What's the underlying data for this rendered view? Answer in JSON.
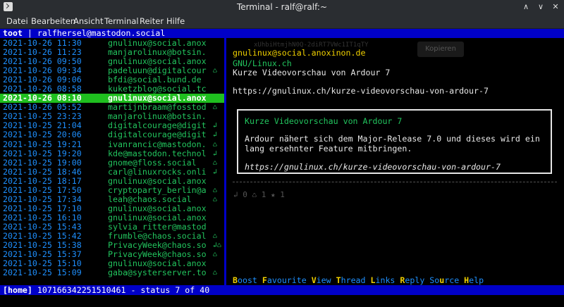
{
  "window": {
    "title": "Terminal - ralf@ralf:~",
    "buttons": {
      "minimize": "∧",
      "maximize": "∨",
      "close": "✕"
    }
  },
  "menu": [
    "Datei",
    "Bearbeiten",
    "Ansicht",
    "Terminal",
    "Reiter",
    "Hilfe"
  ],
  "header": {
    "app": "toot",
    "separator": " | ",
    "account": "ralfhersel@mastodon.social"
  },
  "timeline": [
    {
      "date": "2021-10-26 11:30",
      "account": "gnulinux@social.anox",
      "flag": ""
    },
    {
      "date": "2021-10-26 11:23",
      "account": "manjarolinux@botsin.",
      "flag": ""
    },
    {
      "date": "2021-10-26 09:50",
      "account": "gnulinux@social.anox",
      "flag": ""
    },
    {
      "date": "2021-10-26 09:34",
      "account": "padeluun@digitalcour",
      "flag": "♺"
    },
    {
      "date": "2021-10-26 09:06",
      "account": "bfdi@social.bund.de",
      "flag": ""
    },
    {
      "date": "2021-10-26 08:58",
      "account": "kuketzblog@social.tc",
      "flag": ""
    },
    {
      "date": "2021-10-26 08:10",
      "account": "gnulinux@social.anox",
      "flag": "",
      "selected": true
    },
    {
      "date": "2021-10-26 05:52",
      "account": "martijnbraam@fosstod",
      "flag": "♺"
    },
    {
      "date": "2021-10-25 23:23",
      "account": "manjarolinux@botsin.",
      "flag": ""
    },
    {
      "date": "2021-10-25 21:04",
      "account": "digitalcourage@digit",
      "flag": "↲"
    },
    {
      "date": "2021-10-25 20:06",
      "account": "digitalcourage@digit",
      "flag": "↲"
    },
    {
      "date": "2021-10-25 19:21",
      "account": "ivanrancic@mastodon.",
      "flag": "♺"
    },
    {
      "date": "2021-10-25 19:20",
      "account": "kde@mastodon.technol",
      "flag": "↲"
    },
    {
      "date": "2021-10-25 19:00",
      "account": "gnome@floss.social",
      "flag": "♺"
    },
    {
      "date": "2021-10-25 18:46",
      "account": "carl@linuxrocks.onli",
      "flag": "↲"
    },
    {
      "date": "2021-10-25 18:17",
      "account": "gnulinux@social.anox",
      "flag": ""
    },
    {
      "date": "2021-10-25 17:50",
      "account": "cryptoparty_berlin@a",
      "flag": "♺"
    },
    {
      "date": "2021-10-25 17:34",
      "account": "leah@chaos.social",
      "flag": "♺"
    },
    {
      "date": "2021-10-25 17:10",
      "account": "gnulinux@social.anox",
      "flag": ""
    },
    {
      "date": "2021-10-25 16:10",
      "account": "gnulinux@social.anox",
      "flag": ""
    },
    {
      "date": "2021-10-25 15:43",
      "account": "sylvia_ritter@mastod",
      "flag": ""
    },
    {
      "date": "2021-10-25 15:42",
      "account": "frumble@chaos.social",
      "flag": "♺"
    },
    {
      "date": "2021-10-25 15:38",
      "account": "PrivacyWeek@chaos.so",
      "flag": "↲♺"
    },
    {
      "date": "2021-10-25 15:37",
      "account": "PrivacyWeek@chaos.so",
      "flag": "♺"
    },
    {
      "date": "2021-10-25 15:10",
      "account": "gnulinux@social.anox",
      "flag": ""
    },
    {
      "date": "2021-10-25 15:09",
      "account": "gaba@systerserver.to",
      "flag": "♺"
    }
  ],
  "status": {
    "display_name": "GNU/Linux.ch",
    "account": "gnulinux@social.anoxinon.de",
    "text": "Kurze Videovorschau von Ardour 7",
    "url": "https://gnulinux.ch/kurze-videovorschau-von-ardour-7",
    "card": {
      "title": "Kurze Videovorschau von Ardour 7",
      "description": "Ardour nähert sich dem Major-Release 7.0 und dieses wird ein lang ersehnter Feature mitbringen.",
      "url": "https://gnulinux.ch/kurze-videovorschau-von-ardour-7"
    },
    "stats": "↲ 0 ♺ 1 ★ 1"
  },
  "ghost": {
    "text": "xUhbiHtmjhN0Q-2diRT7VWc1IT1qTY",
    "button": "Kopieren"
  },
  "actions": [
    {
      "key": "B",
      "rest": "oost"
    },
    {
      "key": "F",
      "rest": "avourite"
    },
    {
      "key": "V",
      "rest": "iew"
    },
    {
      "key": "T",
      "rest": "hread"
    },
    {
      "key": "L",
      "rest": "inks"
    },
    {
      "key": "R",
      "rest": "eply"
    },
    {
      "pre": "So",
      "key": "u",
      "rest": "rce"
    },
    {
      "key": "H",
      "rest": "elp"
    }
  ],
  "footer": {
    "view": "[home]",
    "status_id": "107166342251510461",
    "position": " - status 7 of 40"
  }
}
